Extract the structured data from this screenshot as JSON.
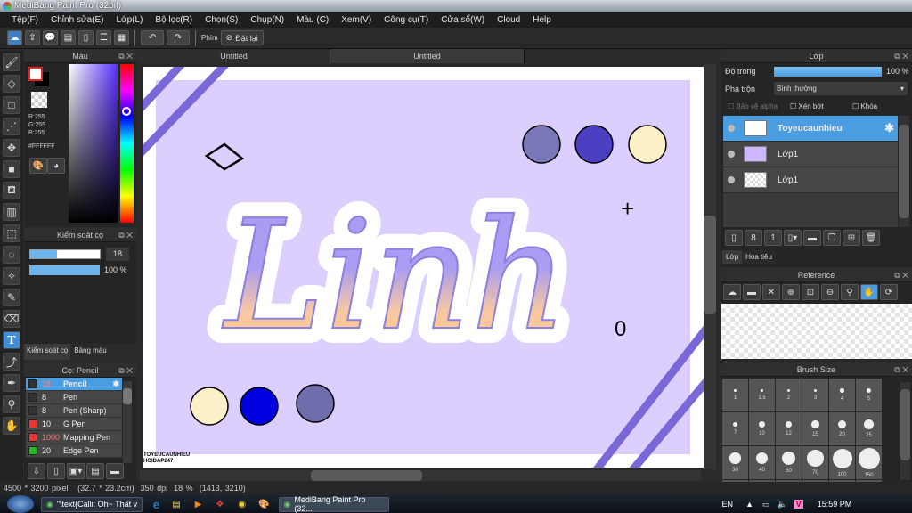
{
  "window": {
    "title": "MediBang Paint Pro (32bit)"
  },
  "menu": [
    "Tệp(F)",
    "Chỉnh sửa(E)",
    "Lớp(L)",
    "Bộ lọc(R)",
    "Chọn(S)",
    "Chụp(N)",
    "Màu (C)",
    "Xem(V)",
    "Công cụ(T)",
    "Cửa sổ(W)",
    "Cloud",
    "Help"
  ],
  "toolbar": {
    "key_label": "Phím",
    "reset_label": "Đặt lại"
  },
  "color_panel": {
    "title": "Màu",
    "r": "R:255",
    "g": "G:255",
    "b": "B:255",
    "hex": "#FFFFFF",
    "foreground": "#FFFFFF",
    "background": "#000000"
  },
  "brush_control": {
    "title": "Kiểm soát cọ",
    "size": "18",
    "size_fraction": 0.38,
    "opacity": "100 %",
    "tabs": [
      "Kiểm soát cọ",
      "Bảng màu"
    ]
  },
  "brush_list": {
    "title": "Cọ: Pencil",
    "items": [
      {
        "size": "18",
        "name": "Pencil",
        "color": "#333333",
        "selected": true
      },
      {
        "size": "8",
        "name": "Pen",
        "color": "#333333"
      },
      {
        "size": "8",
        "name": "Pen (Sharp)",
        "color": "#333333"
      },
      {
        "size": "10",
        "name": "G Pen",
        "color": "#ee3333"
      },
      {
        "size": "1000",
        "name": "Mapping Pen",
        "color": "#ee3333"
      },
      {
        "size": "20",
        "name": "Edge Pen",
        "color": "#22bb22"
      }
    ]
  },
  "documents": {
    "tabs": [
      "Untitled",
      "Untitled"
    ]
  },
  "canvas": {
    "artwork_text": "Linh",
    "watermark1": "TOYEUCAUNHIEU",
    "watermark2": "HOIDAP247",
    "palette_top": [
      "#7a78b8",
      "#4b3fc4",
      "#fdf0c8"
    ],
    "palette_bottom": [
      "#fdf0c8",
      "#0000e0",
      "#6e6eac"
    ],
    "doodle_plus": "+",
    "doodle_o": "0"
  },
  "layer_panel": {
    "title": "Lớp",
    "opacity_label": "Độ trong",
    "opacity": "100 %",
    "blend_label": "Pha trộn",
    "blend": "Bình thường",
    "protect_alpha": "Bảo vệ alpha",
    "clip": "Xén bớt",
    "lock": "Khóa",
    "layers": [
      {
        "name": "Toyeucaunhieu",
        "selected": true
      },
      {
        "name": "Lớp1"
      },
      {
        "name": "Lớp1"
      }
    ],
    "tabs": [
      "Lớp",
      "Hoa tiêu"
    ]
  },
  "reference": {
    "title": "Reference"
  },
  "brush_size": {
    "title": "Brush Size",
    "sizes": [
      "1",
      "1.5",
      "2",
      "3",
      "4",
      "5",
      "7",
      "10",
      "12",
      "15",
      "20",
      "25",
      "30",
      "40",
      "50",
      "70",
      "100",
      "150"
    ]
  },
  "status": {
    "dimensions": "4500 * 3200 pixel",
    "physical": "(32.7 * 23.2cm)",
    "dpi": "350 dpi",
    "zoom": "18 %",
    "coords": "(1413, 3210)"
  },
  "taskbar": {
    "task1": "\"\\text{Calli: Oh~ Thất v...",
    "task2": "MediBang Paint Pro (32...",
    "lang": "EN",
    "time": "15:59 PM"
  }
}
